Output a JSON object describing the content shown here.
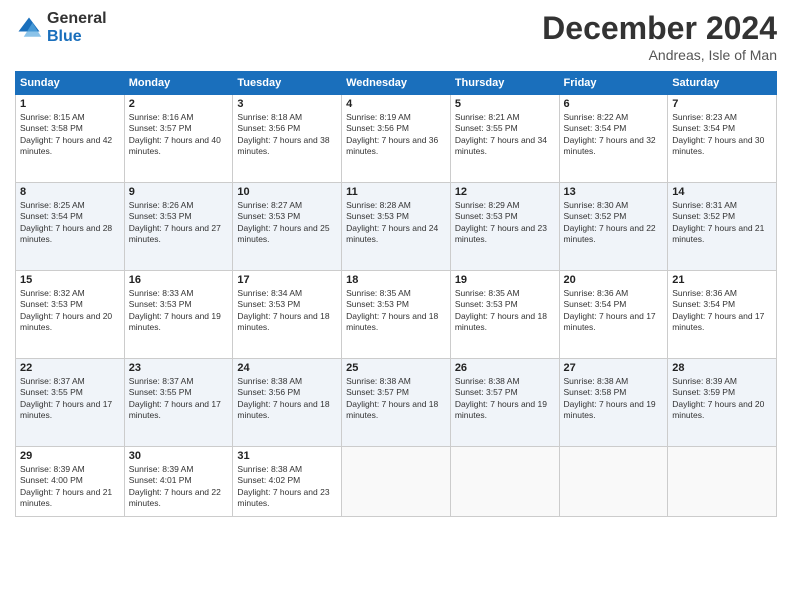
{
  "logo": {
    "general": "General",
    "blue": "Blue"
  },
  "header": {
    "title": "December 2024",
    "subtitle": "Andreas, Isle of Man"
  },
  "days": [
    "Sunday",
    "Monday",
    "Tuesday",
    "Wednesday",
    "Thursday",
    "Friday",
    "Saturday"
  ],
  "weeks": [
    [
      {
        "day": "1",
        "sunrise": "Sunrise: 8:15 AM",
        "sunset": "Sunset: 3:58 PM",
        "daylight": "Daylight: 7 hours and 42 minutes."
      },
      {
        "day": "2",
        "sunrise": "Sunrise: 8:16 AM",
        "sunset": "Sunset: 3:57 PM",
        "daylight": "Daylight: 7 hours and 40 minutes."
      },
      {
        "day": "3",
        "sunrise": "Sunrise: 8:18 AM",
        "sunset": "Sunset: 3:56 PM",
        "daylight": "Daylight: 7 hours and 38 minutes."
      },
      {
        "day": "4",
        "sunrise": "Sunrise: 8:19 AM",
        "sunset": "Sunset: 3:56 PM",
        "daylight": "Daylight: 7 hours and 36 minutes."
      },
      {
        "day": "5",
        "sunrise": "Sunrise: 8:21 AM",
        "sunset": "Sunset: 3:55 PM",
        "daylight": "Daylight: 7 hours and 34 minutes."
      },
      {
        "day": "6",
        "sunrise": "Sunrise: 8:22 AM",
        "sunset": "Sunset: 3:54 PM",
        "daylight": "Daylight: 7 hours and 32 minutes."
      },
      {
        "day": "7",
        "sunrise": "Sunrise: 8:23 AM",
        "sunset": "Sunset: 3:54 PM",
        "daylight": "Daylight: 7 hours and 30 minutes."
      }
    ],
    [
      {
        "day": "8",
        "sunrise": "Sunrise: 8:25 AM",
        "sunset": "Sunset: 3:54 PM",
        "daylight": "Daylight: 7 hours and 28 minutes."
      },
      {
        "day": "9",
        "sunrise": "Sunrise: 8:26 AM",
        "sunset": "Sunset: 3:53 PM",
        "daylight": "Daylight: 7 hours and 27 minutes."
      },
      {
        "day": "10",
        "sunrise": "Sunrise: 8:27 AM",
        "sunset": "Sunset: 3:53 PM",
        "daylight": "Daylight: 7 hours and 25 minutes."
      },
      {
        "day": "11",
        "sunrise": "Sunrise: 8:28 AM",
        "sunset": "Sunset: 3:53 PM",
        "daylight": "Daylight: 7 hours and 24 minutes."
      },
      {
        "day": "12",
        "sunrise": "Sunrise: 8:29 AM",
        "sunset": "Sunset: 3:53 PM",
        "daylight": "Daylight: 7 hours and 23 minutes."
      },
      {
        "day": "13",
        "sunrise": "Sunrise: 8:30 AM",
        "sunset": "Sunset: 3:52 PM",
        "daylight": "Daylight: 7 hours and 22 minutes."
      },
      {
        "day": "14",
        "sunrise": "Sunrise: 8:31 AM",
        "sunset": "Sunset: 3:52 PM",
        "daylight": "Daylight: 7 hours and 21 minutes."
      }
    ],
    [
      {
        "day": "15",
        "sunrise": "Sunrise: 8:32 AM",
        "sunset": "Sunset: 3:53 PM",
        "daylight": "Daylight: 7 hours and 20 minutes."
      },
      {
        "day": "16",
        "sunrise": "Sunrise: 8:33 AM",
        "sunset": "Sunset: 3:53 PM",
        "daylight": "Daylight: 7 hours and 19 minutes."
      },
      {
        "day": "17",
        "sunrise": "Sunrise: 8:34 AM",
        "sunset": "Sunset: 3:53 PM",
        "daylight": "Daylight: 7 hours and 18 minutes."
      },
      {
        "day": "18",
        "sunrise": "Sunrise: 8:35 AM",
        "sunset": "Sunset: 3:53 PM",
        "daylight": "Daylight: 7 hours and 18 minutes."
      },
      {
        "day": "19",
        "sunrise": "Sunrise: 8:35 AM",
        "sunset": "Sunset: 3:53 PM",
        "daylight": "Daylight: 7 hours and 18 minutes."
      },
      {
        "day": "20",
        "sunrise": "Sunrise: 8:36 AM",
        "sunset": "Sunset: 3:54 PM",
        "daylight": "Daylight: 7 hours and 17 minutes."
      },
      {
        "day": "21",
        "sunrise": "Sunrise: 8:36 AM",
        "sunset": "Sunset: 3:54 PM",
        "daylight": "Daylight: 7 hours and 17 minutes."
      }
    ],
    [
      {
        "day": "22",
        "sunrise": "Sunrise: 8:37 AM",
        "sunset": "Sunset: 3:55 PM",
        "daylight": "Daylight: 7 hours and 17 minutes."
      },
      {
        "day": "23",
        "sunrise": "Sunrise: 8:37 AM",
        "sunset": "Sunset: 3:55 PM",
        "daylight": "Daylight: 7 hours and 17 minutes."
      },
      {
        "day": "24",
        "sunrise": "Sunrise: 8:38 AM",
        "sunset": "Sunset: 3:56 PM",
        "daylight": "Daylight: 7 hours and 18 minutes."
      },
      {
        "day": "25",
        "sunrise": "Sunrise: 8:38 AM",
        "sunset": "Sunset: 3:57 PM",
        "daylight": "Daylight: 7 hours and 18 minutes."
      },
      {
        "day": "26",
        "sunrise": "Sunrise: 8:38 AM",
        "sunset": "Sunset: 3:57 PM",
        "daylight": "Daylight: 7 hours and 19 minutes."
      },
      {
        "day": "27",
        "sunrise": "Sunrise: 8:38 AM",
        "sunset": "Sunset: 3:58 PM",
        "daylight": "Daylight: 7 hours and 19 minutes."
      },
      {
        "day": "28",
        "sunrise": "Sunrise: 8:39 AM",
        "sunset": "Sunset: 3:59 PM",
        "daylight": "Daylight: 7 hours and 20 minutes."
      }
    ],
    [
      {
        "day": "29",
        "sunrise": "Sunrise: 8:39 AM",
        "sunset": "Sunset: 4:00 PM",
        "daylight": "Daylight: 7 hours and 21 minutes."
      },
      {
        "day": "30",
        "sunrise": "Sunrise: 8:39 AM",
        "sunset": "Sunset: 4:01 PM",
        "daylight": "Daylight: 7 hours and 22 minutes."
      },
      {
        "day": "31",
        "sunrise": "Sunrise: 8:38 AM",
        "sunset": "Sunset: 4:02 PM",
        "daylight": "Daylight: 7 hours and 23 minutes."
      },
      null,
      null,
      null,
      null
    ]
  ]
}
